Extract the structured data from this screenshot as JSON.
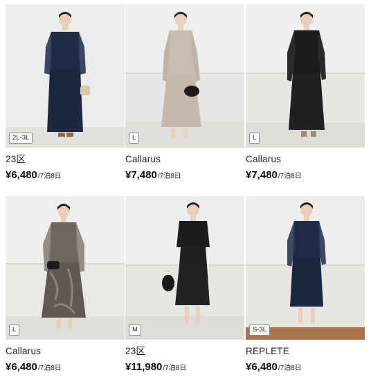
{
  "products": [
    {
      "brand": "23区",
      "price": "¥6,480",
      "rental": "/7泊8日",
      "size": "2L-3L"
    },
    {
      "brand": "Callarus",
      "price": "¥7,480",
      "rental": "/7泊8日",
      "size": "L"
    },
    {
      "brand": "Callarus",
      "price": "¥7,480",
      "rental": "/7泊8日",
      "size": "L"
    },
    {
      "brand": "Callarus",
      "price": "¥6,480",
      "rental": "/7泊8日",
      "size": "L"
    },
    {
      "brand": "23区",
      "price": "¥11,980",
      "rental": "/7泊8日",
      "size": "M"
    },
    {
      "brand": "REPLETE",
      "price": "¥6,480",
      "rental": "/7泊8日",
      "size": "S-3L"
    }
  ],
  "colors": {
    "navy": "#1f2a44",
    "beige": "#c9bcb0",
    "black": "#1c1c1e",
    "mauve_gray": "#6e6660",
    "background": "#e9e7e2"
  }
}
